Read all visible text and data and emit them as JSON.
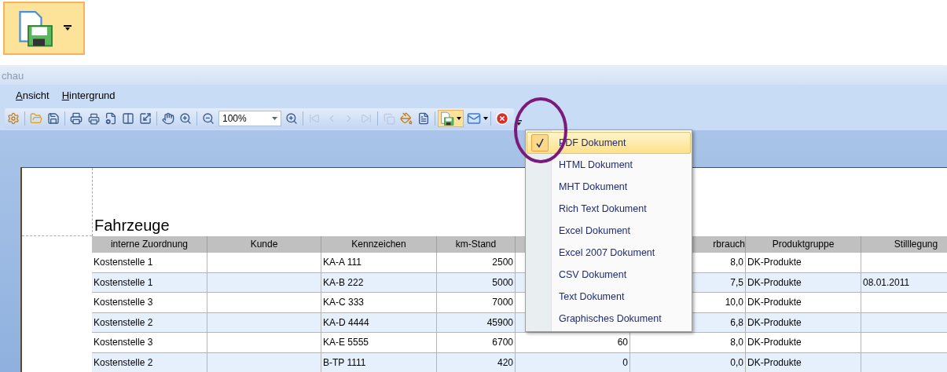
{
  "enlarged_button": {
    "highlighted": true
  },
  "window": {
    "title": "chau"
  },
  "menu_bar": [
    {
      "label": "Ansicht",
      "underline_first": true
    },
    {
      "label": "Hintergrund",
      "underline_first": true
    }
  ],
  "toolbar": {
    "zoom_value": "100%",
    "navigation_disabled": true,
    "export_open": true
  },
  "export_menu": [
    {
      "label": "PDF Dokument",
      "selected": true
    },
    {
      "label": "HTML Dokument",
      "selected": false
    },
    {
      "label": "MHT Dokument",
      "selected": false
    },
    {
      "label": "Rich Text Dokument",
      "selected": false
    },
    {
      "label": "Excel Dokument",
      "selected": false
    },
    {
      "label": "Excel 2007 Dokument",
      "selected": false
    },
    {
      "label": "CSV Dokument",
      "selected": false
    },
    {
      "label": "Text Dokument",
      "selected": false
    },
    {
      "label": "Graphisches Dokument",
      "selected": false
    }
  ],
  "report": {
    "title": "Fahrzeuge",
    "table": {
      "columns": [
        "interne Zuordnung",
        "Kunde",
        "Kennzeichen",
        "km-Stand",
        null,
        "rbrauch",
        "Produktgruppe",
        "Stilllegung"
      ],
      "rows": [
        [
          "Kostenstelle 1",
          null,
          "KA-A 111",
          "2500",
          null,
          "8,0",
          "DK-Produkte",
          null
        ],
        [
          "Kostenstelle 1",
          null,
          "KA-B 222",
          "5000",
          null,
          "7,5",
          "DK-Produkte",
          "08.01.2011"
        ],
        [
          "Kostenstelle 3",
          null,
          "KA-C 333",
          "7000",
          null,
          "10,0",
          "DK-Produkte",
          null
        ],
        [
          "Kostenstelle 2",
          null,
          "KA-D 4444",
          "45900",
          null,
          "6,8",
          "DK-Produkte",
          null
        ],
        [
          "Kostenstelle 3",
          null,
          "KA-E 5555",
          "6700",
          "60",
          "8,0",
          "DK-Produkte",
          null
        ],
        [
          "Kostenstelle 2",
          null,
          "B-TP 1111",
          "420",
          "0",
          "0,0",
          "DK-Produkte",
          null
        ]
      ]
    }
  }
}
